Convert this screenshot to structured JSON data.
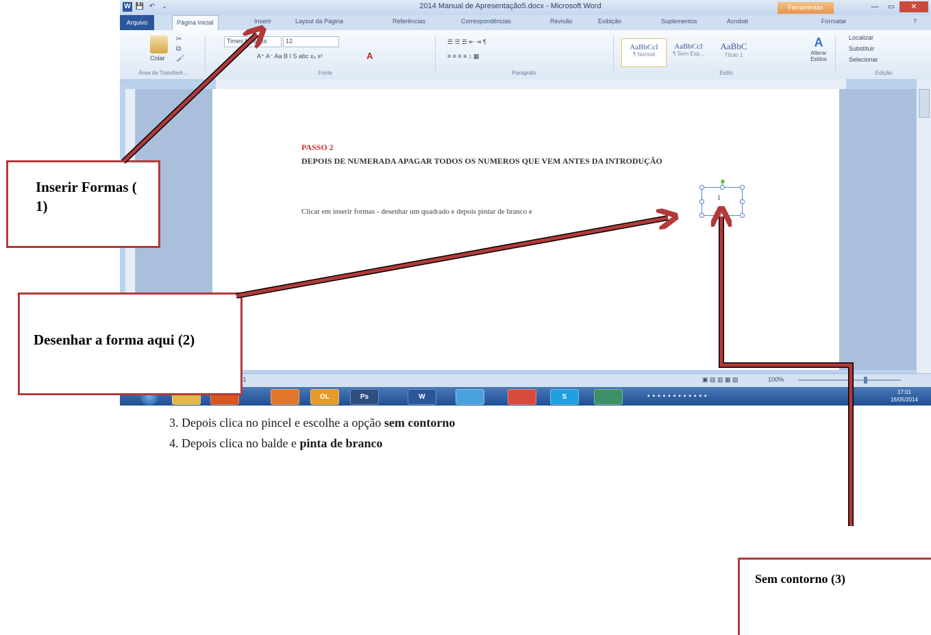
{
  "window": {
    "title": "2014 Manual de Apresentação5.docx - Microsoft Word",
    "contextual_tab": "Ferramentas",
    "quick_access": [
      "W",
      "💾",
      "↶",
      "⌄"
    ],
    "controls": [
      "—",
      "▭",
      "✕"
    ]
  },
  "ribbon_tabs": {
    "file": "Arquivo",
    "items": [
      "Página Inicial",
      "Inserir",
      "Layout da Página",
      "Referências",
      "Correspondências",
      "Revisão",
      "Exibição",
      "Suplementos",
      "Acrobat",
      "Formatar"
    ]
  },
  "ribbon": {
    "paste_label": "Colar",
    "font_name": "Times New Ro",
    "font_size": "12",
    "font_tools": "A⁺ A⁻ Aa  B I S abc x₂ x²",
    "paragraph_tools": "☰ ☰ ☰  ⇤ ⇥  ¶",
    "styles": [
      {
        "preview": "AaBbCcI",
        "name": "¶ Normal"
      },
      {
        "preview": "AaBbCcI",
        "name": "¶ Sem Esp..."
      },
      {
        "preview": "AaBbC",
        "name": "Título 1"
      }
    ],
    "change_styles": "Alterar Estilos",
    "editing": [
      "Localizar",
      "Substituir",
      "Selecionar"
    ],
    "groups": {
      "clipboard": "Área de Transferê...",
      "font": "Fonte",
      "paragraph": "Parágrafo",
      "styles": "Estilo",
      "editing": "Edição"
    }
  },
  "document": {
    "step": "PASSO 2",
    "heading": "DEPOIS DE NUMERADA APAGAR TODOS OS NUMEROS  QUE VEM ANTES DA INTRODUÇÃO",
    "instruction": "Clicar em inserir formas - desenhar um quadrado e depois pintar de branco e",
    "shape_text": "1"
  },
  "statusbar": {
    "words": "5.281",
    "zoom": "100%"
  },
  "taskbar": {
    "apps": [
      "",
      "",
      "",
      "",
      "OL",
      "Ps",
      "W",
      "",
      "",
      "S",
      ""
    ],
    "time": "17:01",
    "date": "16/05/2014"
  },
  "callouts": {
    "insert_shapes": "Inserir Formas ( 1)",
    "draw_here": "Desenhar a forma aqui (2)",
    "no_outline": "Sem contorno (3)"
  },
  "steps": {
    "step3_prefix": "3. Depois clica no pincel e escolhe a opção ",
    "step3_bold": "sem contorno",
    "step4_prefix": "4. Depois clica no balde e ",
    "step4_bold": "pinta de branco"
  },
  "colors": {
    "accent_red": "#b23a3a",
    "word_blue": "#2b579a",
    "passo_red": "#d62b2b"
  }
}
